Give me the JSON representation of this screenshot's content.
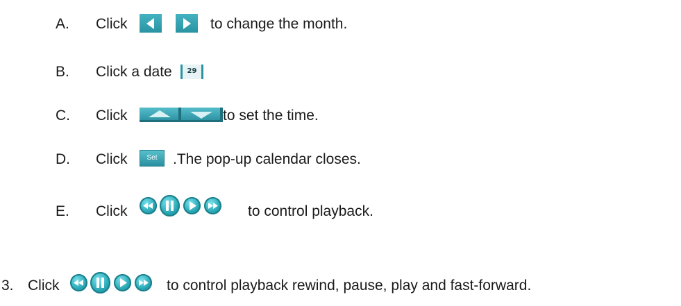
{
  "steps": {
    "a": {
      "marker": "A.",
      "click": "Click",
      "rest": "to change the month.",
      "icons": [
        "arrow-left-icon",
        "arrow-right-icon"
      ]
    },
    "b": {
      "marker": "B.",
      "text": "Click a date",
      "date_chip": "29"
    },
    "c": {
      "marker": "C.",
      "click": "Click",
      "rest": "to set the time.",
      "icons": [
        "arrow-up-icon",
        "arrow-down-icon"
      ]
    },
    "d": {
      "marker": "D.",
      "click": "Click",
      "set_label": "Set",
      "rest": ".The pop-up calendar closes."
    },
    "e": {
      "marker": "E.",
      "click": "Click",
      "rest": "to control playback.",
      "icons": [
        "rewind-icon",
        "pause-icon",
        "play-icon",
        "fast-forward-icon"
      ]
    }
  },
  "item3": {
    "marker": "3.",
    "click": "Click",
    "rest": "to control playback rewind, pause, play and fast-forward.",
    "icons": [
      "rewind-icon",
      "pause-icon",
      "play-icon",
      "fast-forward-icon"
    ]
  },
  "colors": {
    "accent": "#2a93a2",
    "text": "#1a1a1a"
  }
}
